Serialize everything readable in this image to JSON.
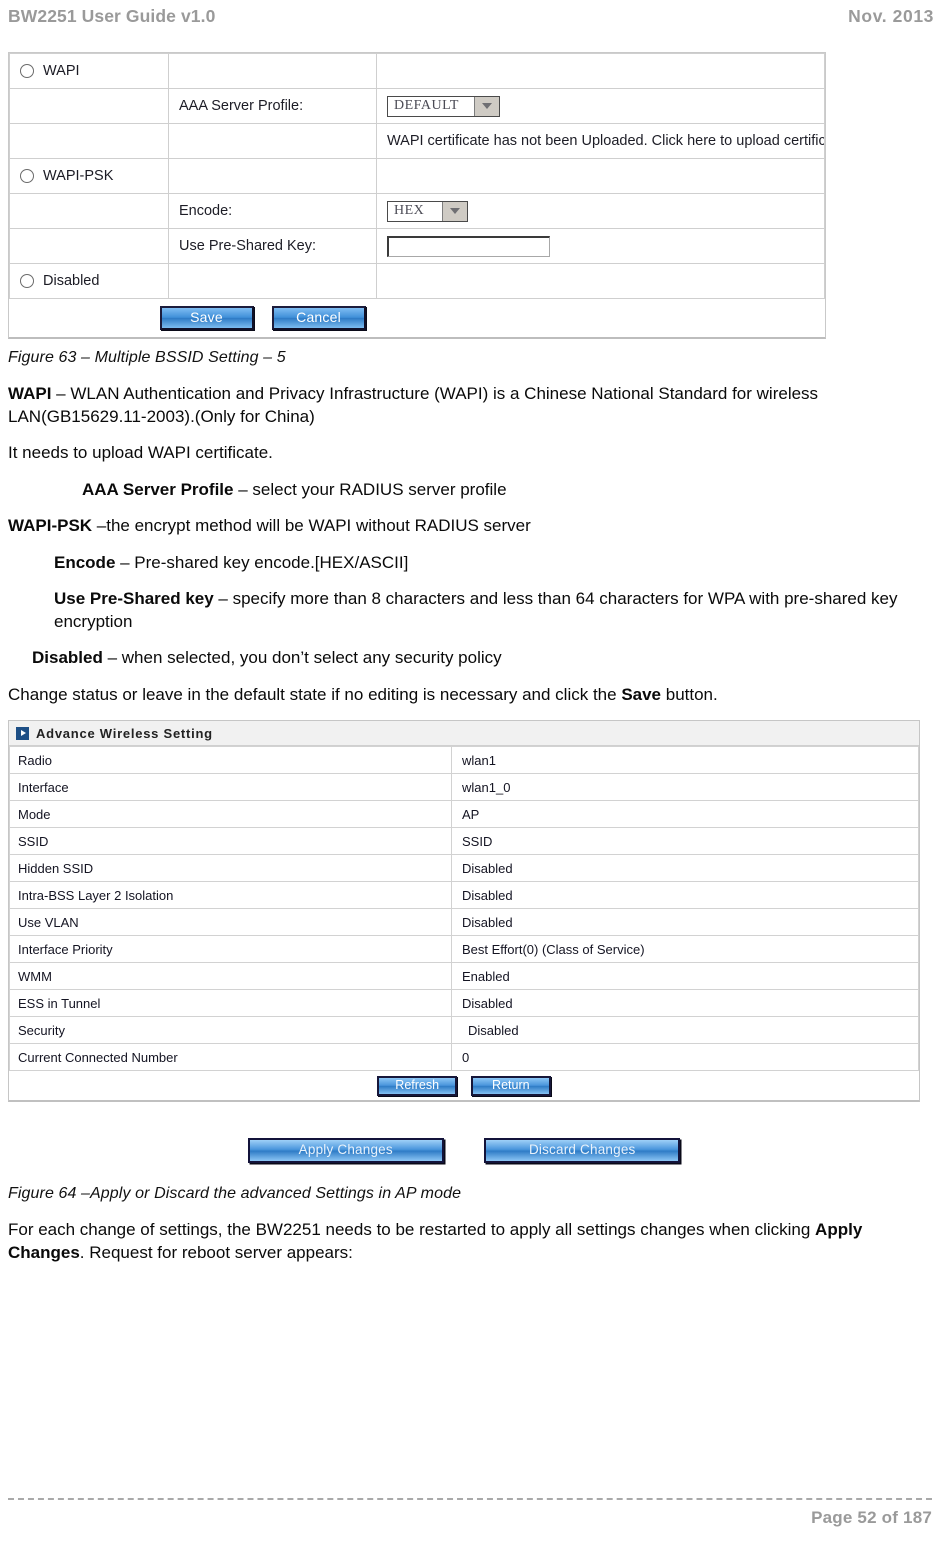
{
  "header": {
    "left": "BW2251 User Guide v1.0",
    "right": "Nov.  2013"
  },
  "wapi_form": {
    "rows": [
      {
        "radio_label": "WAPI"
      },
      {
        "field_label": "AAA Server Profile:",
        "control": "select",
        "value": "DEFAULT"
      },
      {
        "notice": "WAPI certificate has not been Uploaded. Click here to upload certificate."
      },
      {
        "radio_label": "WAPI-PSK"
      },
      {
        "field_label": "Encode:",
        "control": "select",
        "value": "HEX"
      },
      {
        "field_label": "Use Pre-Shared Key:",
        "control": "text",
        "value": ""
      },
      {
        "radio_label": "Disabled"
      }
    ],
    "radio_wapi": "WAPI",
    "radio_wapi_psk": "WAPI-PSK",
    "radio_disabled": "Disabled",
    "label_aaa": "AAA Server Profile:",
    "value_aaa": "DEFAULT",
    "notice_text": "WAPI certificate has not been Uploaded. Click here to upload certificate.",
    "label_encode": "Encode:",
    "value_encode": "HEX",
    "label_psk": "Use Pre-Shared Key:",
    "value_psk": "",
    "save_label": "Save",
    "cancel_label": "Cancel"
  },
  "figure63": {
    "caption": "Figure 63 – Multiple BSSID Setting – 5"
  },
  "body_text": {
    "wapi_term": "WAPI",
    "wapi_desc": " –  WLAN Authentication and Privacy Infrastructure (WAPI) is a Chinese National Standard for wireless LAN(GB15629.11-2003).(Only for China)",
    "upload_line": "It needs to upload WAPI certificate.",
    "aaa_term": "AAA Server Profile",
    "aaa_desc": " – select your RADIUS server profile",
    "wapipsk_term": "WAPI-PSK",
    "wapipsk_desc": "  –the encrypt method will be WAPI without RADIUS server",
    "encode_term": "Encode",
    "encode_desc": " – Pre-shared key encode.[HEX/ASCII]",
    "psk_term": "Use Pre-Shared key",
    "psk_desc": " – specify more than 8 characters and less than 64 characters for WPA with pre-shared key encryption",
    "disabled_term": "Disabled",
    "disabled_desc": " – when selected, you don’t select any security policy",
    "change_status_pre": "Change status or leave in the default state if no editing is necessary and click the ",
    "change_status_bold": "Save",
    "change_status_post": " button."
  },
  "advance_wireless": {
    "panel_title": "Advance Wireless Setting",
    "panel_icon": "arrow-right-icon",
    "rows": [
      {
        "key": "Radio",
        "value": "wlan1"
      },
      {
        "key": "Interface",
        "value": "wlan1_0"
      },
      {
        "key": "Mode",
        "value": "AP"
      },
      {
        "key": "SSID",
        "value": "SSID"
      },
      {
        "key": "Hidden SSID",
        "value": "Disabled"
      },
      {
        "key": "Intra-BSS Layer 2 Isolation",
        "value": "Disabled"
      },
      {
        "key": "Use VLAN",
        "value": "Disabled"
      },
      {
        "key": "Interface Priority",
        "value": "Best Effort(0)  (Class of Service)"
      },
      {
        "key": "WMM",
        "value": "Enabled"
      },
      {
        "key": "ESS in Tunnel",
        "value": "Disabled"
      },
      {
        "key": "Security",
        "value": "Disabled"
      },
      {
        "key": "Current Connected Number",
        "value": "0"
      }
    ],
    "refresh_label": "Refresh",
    "return_label": "Return"
  },
  "apply_bar": {
    "apply_label": "Apply Changes",
    "discard_label": "Discard Changes"
  },
  "figure64": {
    "caption": "Figure 64 –Apply or Discard the advanced Settings in AP mode"
  },
  "closing_text": {
    "pre": "For each change of settings, the BW2251 needs to be restarted to apply all settings changes when clicking ",
    "bold": "Apply Changes",
    "post": ". Request for reboot server appears:"
  },
  "footer": {
    "page": "Page 52 of 187"
  },
  "colors": {
    "header_gray": "#9a9a9a",
    "button_blue": "#3f8fd8",
    "panel_icon_blue": "#1d4f86"
  }
}
